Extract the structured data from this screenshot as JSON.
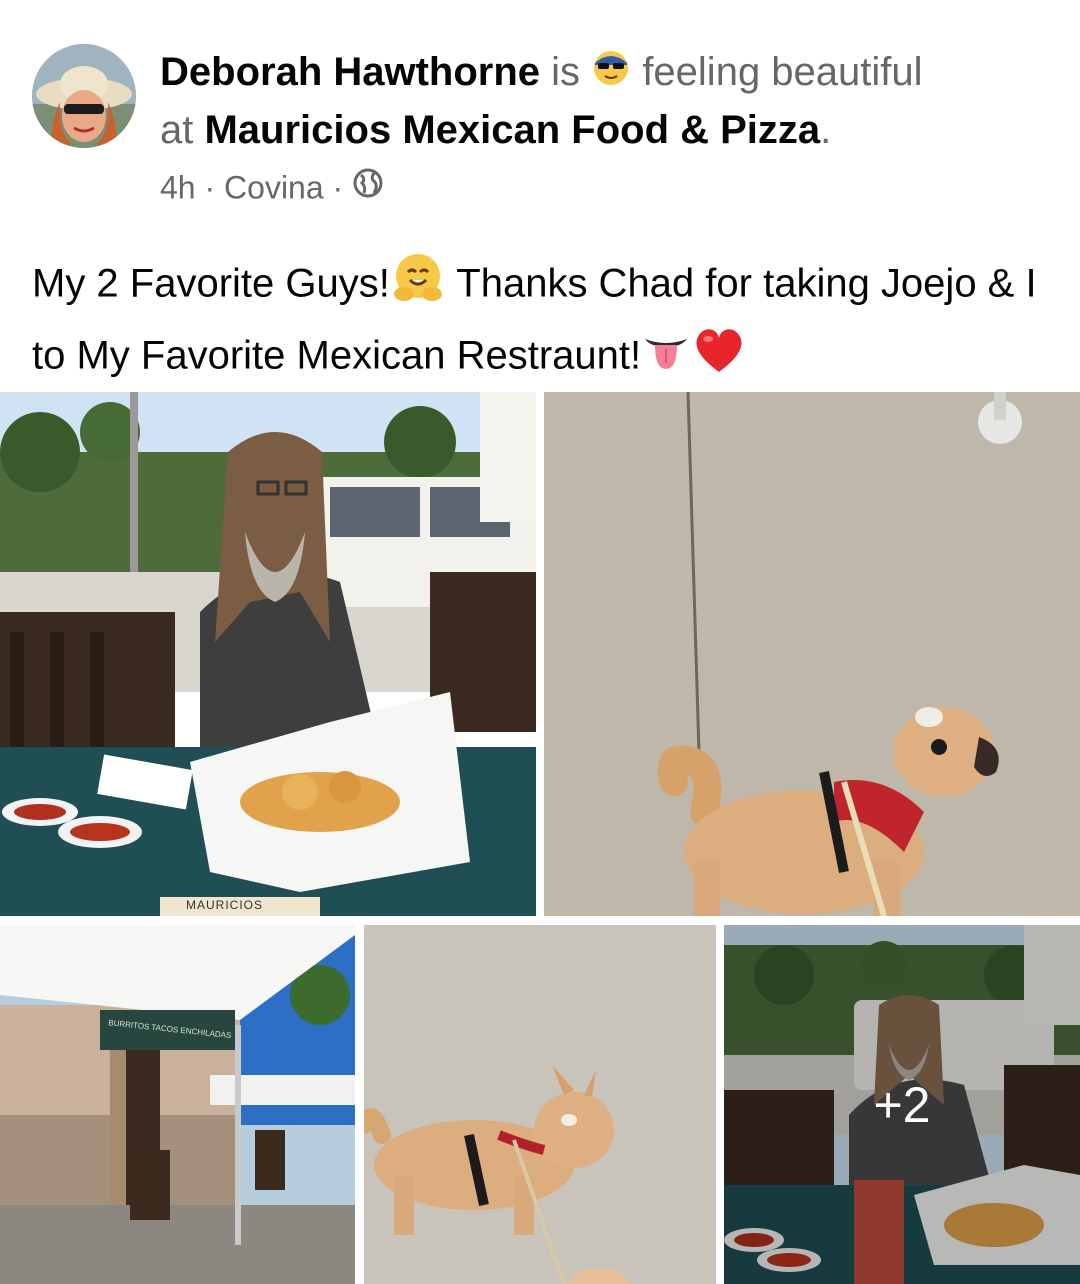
{
  "post": {
    "author": "Deborah Hawthorne",
    "is_text": "is",
    "feeling_text": "feeling beautiful",
    "at_text": "at",
    "place": "Mauricios Mexican Food & Pizza",
    "period": ".",
    "time": "4h",
    "location": "Covina",
    "audience_icon": "globe-icon",
    "caption_part1": "My 2 Favorite Guys!",
    "caption_part2": " Thanks Chad for taking Joejo & I to My Favorite Mexican Restraunt!"
  },
  "photos": {
    "more_count": "+2",
    "sign_mauricios": "MAURICIOS",
    "awning_text": "BURRITOS TACOS ENCHILADAS"
  }
}
